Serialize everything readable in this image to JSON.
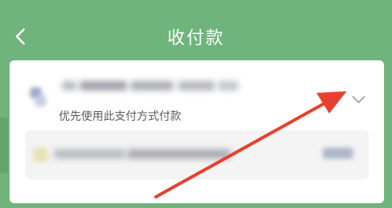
{
  "header": {
    "title": "收付款",
    "back_icon": "chevron-left-icon"
  },
  "payment_method": {
    "subtext": "优先使用此支付方式付款",
    "expand_icon": "chevron-down-icon"
  },
  "colors": {
    "header_background": "#6fb47c",
    "card_background": "#ffffff",
    "annotation_arrow": "#e8402f",
    "subtext": "#555a60"
  }
}
